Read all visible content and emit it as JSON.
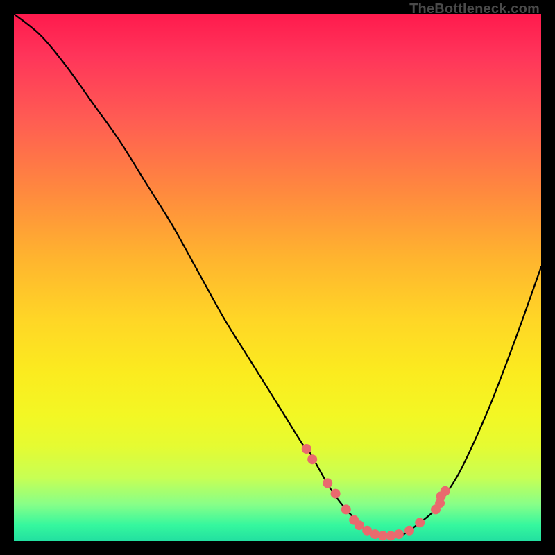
{
  "attribution": "TheBottleneck.com",
  "chart_data": {
    "type": "line",
    "title": "",
    "xlabel": "",
    "ylabel": "",
    "xlim": [
      0,
      100
    ],
    "ylim": [
      0,
      100
    ],
    "series": [
      {
        "name": "bottleneck-curve",
        "x": [
          0,
          5,
          10,
          15,
          20,
          25,
          30,
          35,
          40,
          45,
          50,
          55,
          56,
          60,
          63,
          65,
          67,
          70,
          73,
          75,
          80,
          82,
          85,
          90,
          95,
          100
        ],
        "y": [
          100,
          96,
          90,
          83,
          76,
          68,
          60,
          51,
          42,
          34,
          26,
          18,
          17,
          10,
          6,
          4,
          2,
          1,
          1,
          2,
          6,
          9,
          14,
          25,
          38,
          52
        ]
      }
    ],
    "markers": {
      "name": "highlight-dots",
      "x": [
        55.5,
        56.6,
        59.5,
        61.0,
        63.0,
        64.5,
        65.5,
        67.0,
        68.5,
        70.0,
        71.5,
        73.0,
        75.0,
        77.0,
        80.0,
        80.8,
        81.0,
        81.8
      ],
      "y": [
        17.5,
        15.5,
        11.0,
        9.0,
        6.0,
        4.0,
        3.0,
        2.0,
        1.3,
        1.0,
        1.0,
        1.3,
        2.0,
        3.5,
        6.0,
        7.2,
        8.5,
        9.5
      ]
    },
    "gradient_stops": [
      {
        "pos": 0,
        "color": "#ff1a4d"
      },
      {
        "pos": 50,
        "color": "#ffd626"
      },
      {
        "pos": 100,
        "color": "#22e0a0"
      }
    ]
  }
}
